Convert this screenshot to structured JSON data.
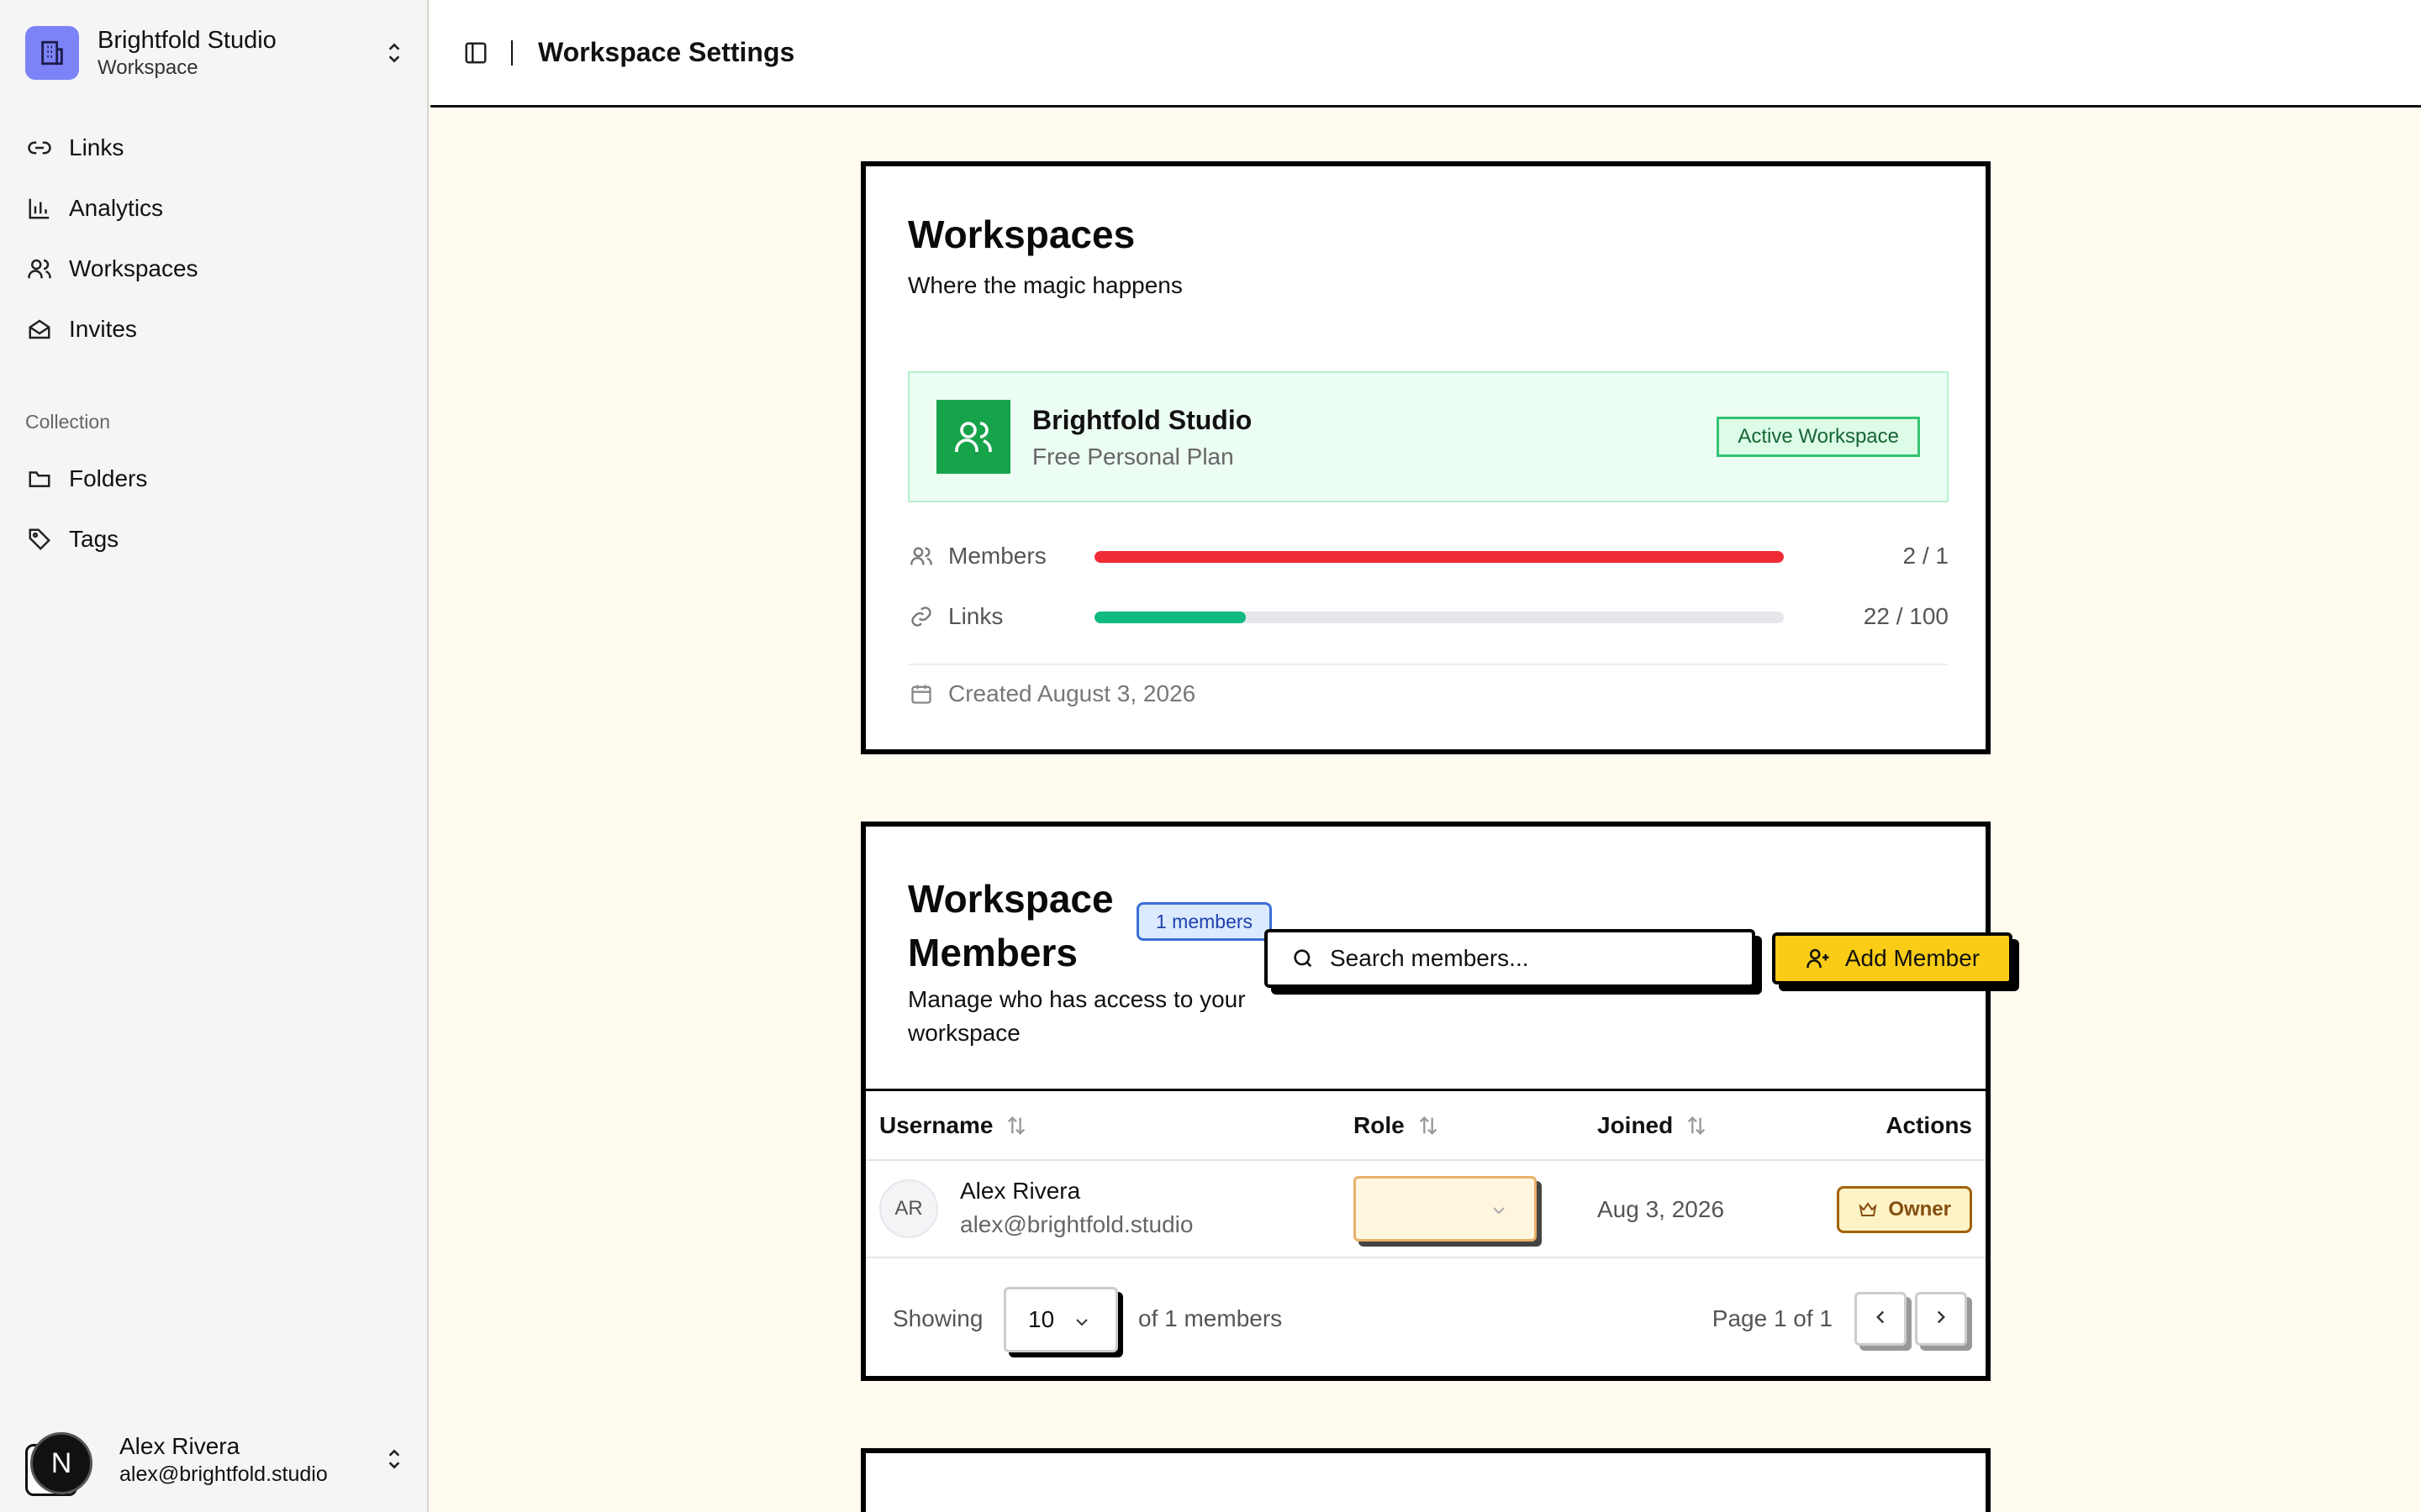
{
  "sidebar": {
    "workspace_name": "Brightfold Studio",
    "workspace_type": "Workspace",
    "nav": [
      {
        "label": "Links",
        "icon": "link-icon"
      },
      {
        "label": "Analytics",
        "icon": "bar-chart-icon"
      },
      {
        "label": "Workspaces",
        "icon": "users-icon"
      },
      {
        "label": "Invites",
        "icon": "mail-open-icon"
      }
    ],
    "collection_label": "Collection",
    "collection": [
      {
        "label": "Folders",
        "icon": "folder-icon"
      },
      {
        "label": "Tags",
        "icon": "tag-icon"
      }
    ],
    "user": {
      "initial": "N",
      "name": "Alex Rivera",
      "email": "alex@brightfold.studio"
    }
  },
  "header": {
    "title": "Workspace Settings"
  },
  "workspace_card": {
    "title": "Workspaces",
    "subtitle": "Where the magic happens",
    "active": {
      "name": "Brightfold Studio",
      "plan": "Free Personal Plan",
      "badge": "Active Workspace"
    },
    "usage": [
      {
        "label": "Members",
        "value": "2 / 1",
        "fraction": 1.0,
        "color": "#ef2b36"
      },
      {
        "label": "Links",
        "value": "22 / 100",
        "fraction": 0.22,
        "color": "#10b981"
      }
    ],
    "created": "Created August 3, 2026"
  },
  "members_card": {
    "title": "Workspace Members",
    "count_badge": "1 members",
    "subtitle": "Manage who has access to your workspace",
    "search_placeholder": "Search members...",
    "add_button": "Add Member",
    "columns": {
      "username": "Username",
      "role": "Role",
      "joined": "Joined",
      "actions": "Actions"
    },
    "rows": [
      {
        "initials": "AR",
        "name": "Alex Rivera",
        "email": "alex@brightfold.studio",
        "role": "",
        "joined": "Aug 3, 2026",
        "action": "Owner"
      }
    ],
    "footer": {
      "showing": "Showing",
      "page_size": "10",
      "of_text": "of 1 members",
      "page_text": "Page 1 of 1"
    }
  },
  "colors": {
    "accent_yellow": "#facc15",
    "active_green": "#17a34a",
    "page_bg": "#fffbef"
  }
}
